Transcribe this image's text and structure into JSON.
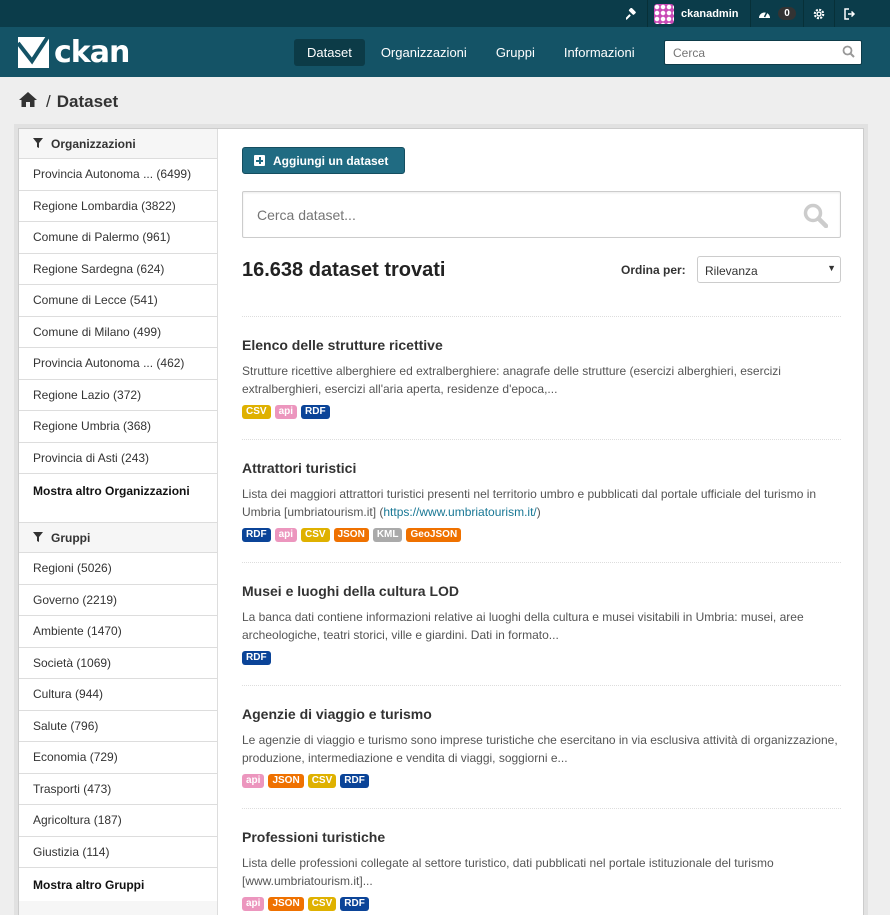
{
  "account": {
    "username": "ckanadmin",
    "activity_count": "0"
  },
  "header": {
    "logo_text": "ckan",
    "nav": [
      "Dataset",
      "Organizzazioni",
      "Gruppi",
      "Informazioni"
    ],
    "search_placeholder": "Cerca"
  },
  "breadcrumb": {
    "current": "Dataset"
  },
  "facets": {
    "organizations": {
      "title": "Organizzazioni",
      "items": [
        "Provincia Autonoma ... (6499)",
        "Regione Lombardia (3822)",
        "Comune di Palermo (961)",
        "Regione Sardegna (624)",
        "Comune di Lecce (541)",
        "Comune di Milano (499)",
        "Provincia Autonoma ... (462)",
        "Regione Lazio (372)",
        "Regione Umbria (368)",
        "Provincia di Asti (243)"
      ],
      "more": "Mostra altro Organizzazioni"
    },
    "groups": {
      "title": "Gruppi",
      "items": [
        "Regioni (5026)",
        "Governo (2219)",
        "Ambiente (1470)",
        "Società (1069)",
        "Cultura (944)",
        "Salute (796)",
        "Economia (729)",
        "Trasporti (473)",
        "Agricoltura (187)",
        "Giustizia (114)"
      ],
      "more": "Mostra altro Gruppi"
    }
  },
  "main": {
    "add_button": "Aggiungi un dataset",
    "search_placeholder": "Cerca dataset...",
    "results_count": "16.638 dataset trovati",
    "sort_label": "Ordina per:",
    "sort_value": "Rilevanza"
  },
  "format_colors": {
    "CSV": "#dfb100",
    "api": "#ec96be",
    "RDF": "#0b4498",
    "JSON": "#ef7100",
    "KML": "#aaaaaa",
    "GeoJSON": "#ef7100"
  },
  "datasets": [
    {
      "title": "Elenco delle strutture ricettive",
      "notes": "Strutture ricettive alberghiere ed extralberghiere: anagrafe delle strutture (esercizi alberghieri, esercizi extralberghieri, esercizi all'aria aperta, residenze d'epoca,...",
      "formats": [
        "CSV",
        "api",
        "RDF"
      ]
    },
    {
      "title": "Attrattori turistici",
      "notes": "Lista dei maggiori attrattori turistici presenti nel territorio umbro e pubblicati dal portale ufficiale del turismo in Umbria [umbriatourism.it] (",
      "link": "https://www.umbriatourism.it/",
      "notes_end": ")",
      "formats": [
        "RDF",
        "api",
        "CSV",
        "JSON",
        "KML",
        "GeoJSON"
      ]
    },
    {
      "title": "Musei e luoghi della cultura LOD",
      "notes": "La banca dati contiene informazioni relative ai luoghi della cultura e musei visitabili in Umbria: musei, aree archeologiche, teatri storici, ville e giardini. Dati in formato...",
      "formats": [
        "RDF"
      ]
    },
    {
      "title": "Agenzie di viaggio e turismo",
      "notes": "Le agenzie di viaggio e turismo sono imprese turistiche che esercitano in via esclusiva attività di organizzazione, produzione, intermediazione e vendita di viaggi, soggiorni e...",
      "formats": [
        "api",
        "JSON",
        "CSV",
        "RDF"
      ]
    },
    {
      "title": "Professioni turistiche",
      "notes": "Lista delle professioni collegate al settore turistico, dati pubblicati nel portale istituzionale del turismo [www.umbriatourism.it]...",
      "formats": [
        "api",
        "JSON",
        "CSV",
        "RDF"
      ]
    }
  ]
}
